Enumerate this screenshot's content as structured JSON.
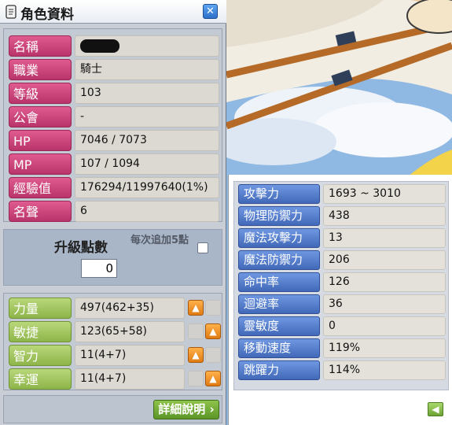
{
  "window": {
    "title": "角色資料"
  },
  "info_rows": [
    {
      "label": "名稱",
      "value": ""
    },
    {
      "label": "職業",
      "value": "騎士"
    },
    {
      "label": "等級",
      "value": "103"
    },
    {
      "label": "公會",
      "value": "-"
    },
    {
      "label": "HP",
      "value": "7046 / 7073"
    },
    {
      "label": "MP",
      "value": "107 / 1094"
    },
    {
      "label": "經驗值",
      "value": "176294/11997640(1%)"
    },
    {
      "label": "名聲",
      "value": "6"
    }
  ],
  "level_up": {
    "label": "升級點數",
    "value": "0",
    "hint": "每次追加5點"
  },
  "attributes": [
    {
      "label": "力量",
      "value": "497(462+35)",
      "up_enabled": true
    },
    {
      "label": "敏捷",
      "value": "123(65+58)",
      "up_enabled": true
    },
    {
      "label": "智力",
      "value": "11(4+7)",
      "up_enabled": true
    },
    {
      "label": "幸運",
      "value": "11(4+7)",
      "up_enabled": true
    }
  ],
  "detail_button": {
    "label": "詳細說明"
  },
  "detail_stats": [
    {
      "label": "攻擊力",
      "value": "1693 ~ 3010"
    },
    {
      "label": "物理防禦力",
      "value": "438"
    },
    {
      "label": "魔法攻擊力",
      "value": "13"
    },
    {
      "label": "魔法防禦力",
      "value": "206"
    },
    {
      "label": "命中率",
      "value": "126"
    },
    {
      "label": "迴避率",
      "value": "36"
    },
    {
      "label": "靈敏度",
      "value": "0"
    },
    {
      "label": "移動速度",
      "value": "119%"
    },
    {
      "label": "跳躍力",
      "value": "114%"
    }
  ],
  "colors": {
    "info_label": "#c83f75",
    "attr_label": "#a3c962",
    "stat_label": "#5a80cc",
    "up_button": "#f29a2e",
    "detail_button": "#76ad3b"
  },
  "icons": {
    "title": "scroll-icon",
    "close": "close-icon",
    "up": "arrow-up-icon",
    "back": "arrow-left-icon"
  }
}
